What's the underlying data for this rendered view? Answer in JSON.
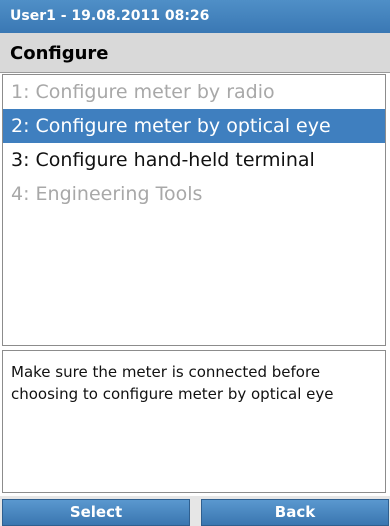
{
  "status": {
    "text": "User1 - 19.08.2011 08:26"
  },
  "header": {
    "title": "Configure"
  },
  "menu": {
    "items": [
      {
        "label": "1: Configure meter by radio",
        "state": "disabled"
      },
      {
        "label": "2: Configure meter by optical eye",
        "state": "selected"
      },
      {
        "label": "3: Configure hand-held terminal",
        "state": "enabled"
      },
      {
        "label": "4: Engineering Tools",
        "state": "disabled"
      }
    ]
  },
  "info": {
    "text": "Make sure the meter is connected before choosing to configure meter by optical eye"
  },
  "softkeys": {
    "left_label": "Select",
    "right_label": "Back"
  },
  "colors": {
    "accent": "#3f7fbf",
    "disabled_text": "#a8a8a8"
  }
}
